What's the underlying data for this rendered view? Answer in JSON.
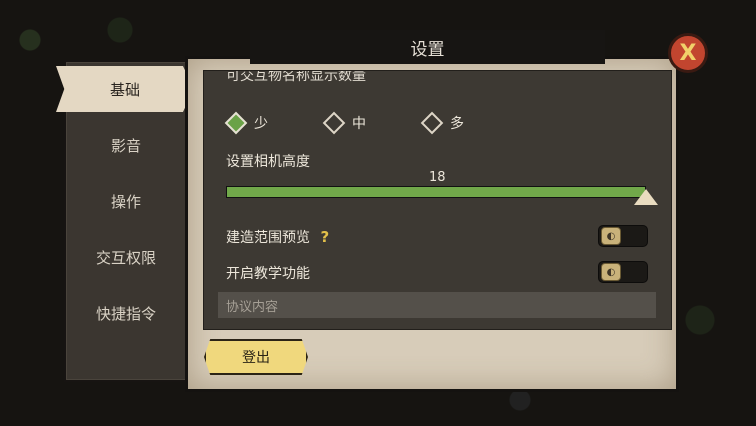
{
  "dialog": {
    "title": "设置",
    "close_icon": "close-x-icon",
    "close_glyph": "X"
  },
  "sidebar": {
    "items": [
      {
        "label": "基础",
        "active": true
      },
      {
        "label": "影音"
      },
      {
        "label": "操作"
      },
      {
        "label": "交互权限"
      },
      {
        "label": "快捷指令"
      }
    ]
  },
  "settings": {
    "interact_name_label": "可交互物名称显示数量",
    "count_options": [
      {
        "label": "少",
        "selected": true
      },
      {
        "label": "中",
        "selected": false
      },
      {
        "label": "多",
        "selected": false
      }
    ],
    "camera_height_label": "设置相机高度",
    "camera_height_value": "18",
    "camera_height_fraction": 1.0,
    "build_preview_label": "建造范围预览",
    "help_icon": "question-icon",
    "help_glyph": "?",
    "tutorial_label": "开启教学功能",
    "toggle_glyph": "◐",
    "agreement_placeholder": "协议内容"
  },
  "footer": {
    "logout_label": "登出"
  },
  "colors": {
    "accent_green": "#71a84a",
    "button_yellow": "#f0d87d",
    "close_red": "#c2452f"
  }
}
